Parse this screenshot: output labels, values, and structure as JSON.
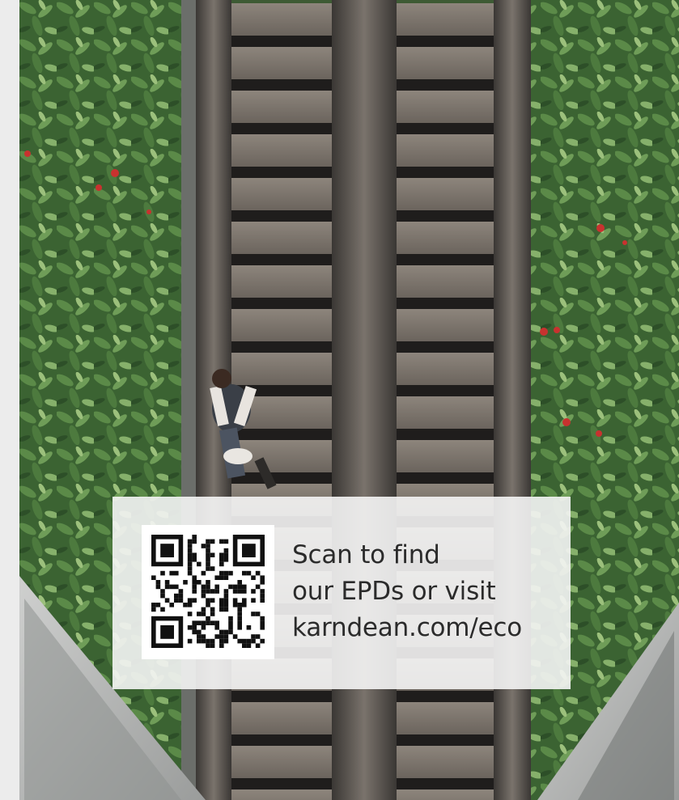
{
  "callout": {
    "lines": [
      "Scan to find",
      "our EPDs or visit",
      "karndean.com/eco"
    ]
  },
  "icons": {
    "qr": "qr-code-icon"
  },
  "colors": {
    "page_background": "#ececec",
    "callout_background": "#f5f5f5",
    "text": "#2b2b2b",
    "foliage": "#3f6b35",
    "escalator_metal": "#5a5550"
  }
}
